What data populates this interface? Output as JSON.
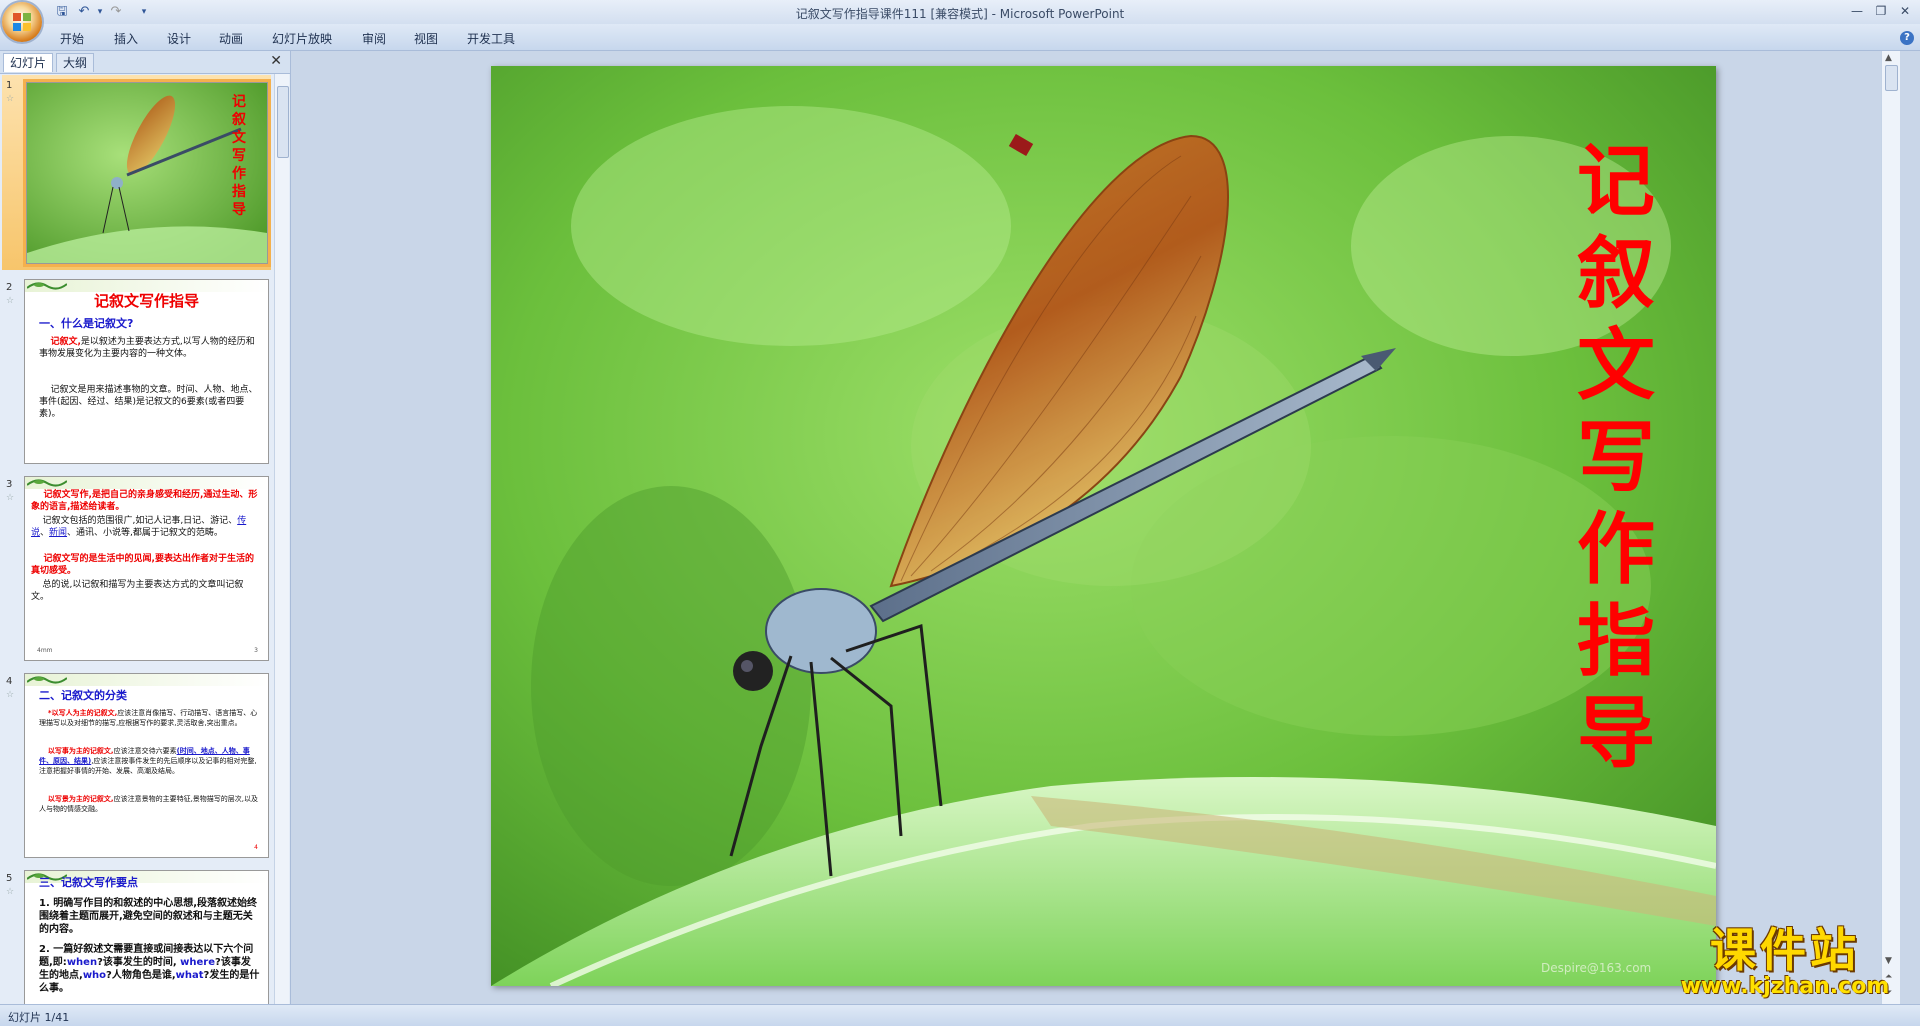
{
  "window": {
    "title": "记叙文写作指导课件111 [兼容模式] - Microsoft PowerPoint",
    "minimize": "—",
    "restore": "❐",
    "close": "✕"
  },
  "qat": {
    "save": "🖫",
    "undo": "↶",
    "undo_dropdown": "▾",
    "redo": "↷",
    "customize": "▾"
  },
  "ribbon": {
    "tabs": [
      "开始",
      "插入",
      "设计",
      "动画",
      "幻灯片放映",
      "审阅",
      "视图",
      "开发工具"
    ],
    "help": "?"
  },
  "panel": {
    "tabs": [
      "幻灯片",
      "大纲"
    ],
    "close": "✕"
  },
  "thumbnails": [
    {
      "number": "1",
      "title": "记叙文写作指导"
    },
    {
      "number": "2",
      "title": "记叙文写作指导",
      "h1": "一、什么是记叙文?",
      "p1_red": "记叙文,",
      "p1": "是以叙述为主要表达方式,以写人物的经历和事物发展变化为主要内容的一种文体。",
      "p2": "记叙文是用来描述事物的文章。时间、人物、地点、事件(起因、经过、结果)是记叙文的6要素(或者四要素)。"
    },
    {
      "number": "3",
      "p1": "记叙文写作,是把自己的亲身感受和经历,通过生动、形象的语言,描述给读者。",
      "p2a": "记叙文包括的范围很广,如记人记事,日记、游记、",
      "p2_link1": "传说",
      "p2_sep": "、",
      "p2_link2": "新闻",
      "p2b": "、通讯、小说等,都属于记叙文的范畴。",
      "p3": "记叙文写的是生活中的见闻,要表达出作者对于生活的真切感受。",
      "p4": "总的说,以记叙和描写为主要表达方式的文章叫记叙文。",
      "foot_left": "4mm",
      "foot_right": "3"
    },
    {
      "number": "4",
      "h1": "二、记叙文的分类",
      "p1_red": "*以写人为主的记叙文,",
      "p1": "应该注意肖像描写、行动描写、语言描写、心理描写以及对细节的描写,应根据写作的要求,灵活取舍,突出重点。",
      "p2_red": "以写事为主的记叙文,",
      "p2": "应该注意交待六要素",
      "p2_blue": "(时间、地点、人物、事件、原因、结果)",
      "p2b": ",应该注意按事件发生的先后顺序以及记事的相对完整,注意把握好事情的开始、发展、高潮及结局。",
      "p3_red": "以写景为主的记叙文,",
      "p3": "应该注意景物的主要特征,景物描写的层次,以及人与物的情感交融。",
      "foot_right": "4"
    },
    {
      "number": "5",
      "h1": "三、记叙文写作要点",
      "p1": "1. 明确写作目的和叙述的中心思想,段落叙述始终围绕着主题而展开,避免空间的叙述和与主题无关的内容。",
      "p2": "2. 一篇好叙述文需要直接或间接表达以下六个问题,即:",
      "q_when": "when",
      "q_when_t": "?该事发生的时间,",
      "q_where": "where",
      "q_where_t": "?该事发生的地点,",
      "q_who": "who",
      "q_who_t": "?人物角色是谁,",
      "q_what": "what",
      "q_what_t": "?发生的是什么事。"
    }
  ],
  "slide": {
    "title": "记叙文写作指导",
    "watermark": "Despire@163.com"
  },
  "brand": {
    "name": "课件站",
    "url": "www.kjzhan.com"
  },
  "status": {
    "text": "幻灯片 1/41"
  },
  "colors": {
    "title_red": "#ff0000",
    "ribbon_bg": "#dfe9f6",
    "selection": "#f7c56b"
  }
}
